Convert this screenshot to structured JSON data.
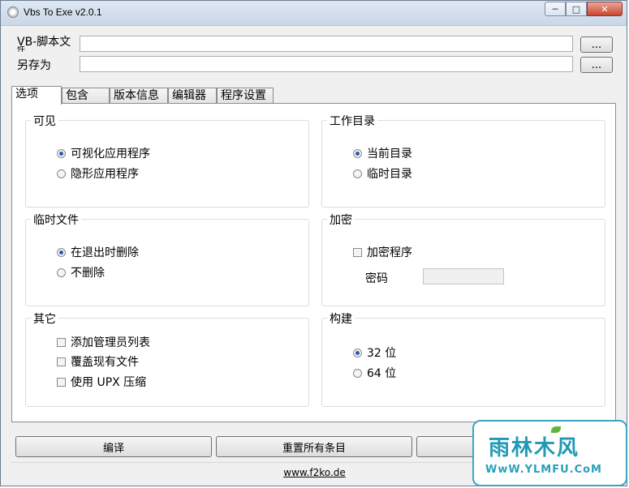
{
  "window": {
    "title": "Vbs To Exe v2.0.1"
  },
  "fields": {
    "vbs_label": "VB-脚本文",
    "vbs_label_ext": "件",
    "vbs_value": "",
    "saveas_label": "另存为",
    "saveas_value": "",
    "browse_label": "..."
  },
  "tabs": [
    "选项",
    "包含",
    "版本信息",
    "编辑器",
    "程序设置"
  ],
  "groups": {
    "visible": {
      "title": "可见",
      "options": [
        "可视化应用程序",
        "隐形应用程序"
      ],
      "selected": 0
    },
    "workdir": {
      "title": "工作目录",
      "options": [
        "当前目录",
        "临时目录"
      ],
      "selected": 0
    },
    "tempfiles": {
      "title": "临时文件",
      "options": [
        "在退出时删除",
        "不删除"
      ],
      "selected": 0
    },
    "encrypt": {
      "title": "加密",
      "checkbox": "加密程序",
      "password_label": "密码",
      "password_value": ""
    },
    "other": {
      "title": "其它",
      "checkboxes": [
        "添加管理员列表",
        "覆盖现有文件",
        "使用 UPX 压缩"
      ]
    },
    "build": {
      "title": "构建",
      "options": [
        "32 位",
        "64 位"
      ],
      "selected": 0
    }
  },
  "buttons": {
    "compile": "编译",
    "reset": "重置所有条目"
  },
  "footer": {
    "link": "www.f2ko.de"
  },
  "watermark": {
    "logo": "雨林木风",
    "url": "WwW.YLMFU.CoM"
  }
}
